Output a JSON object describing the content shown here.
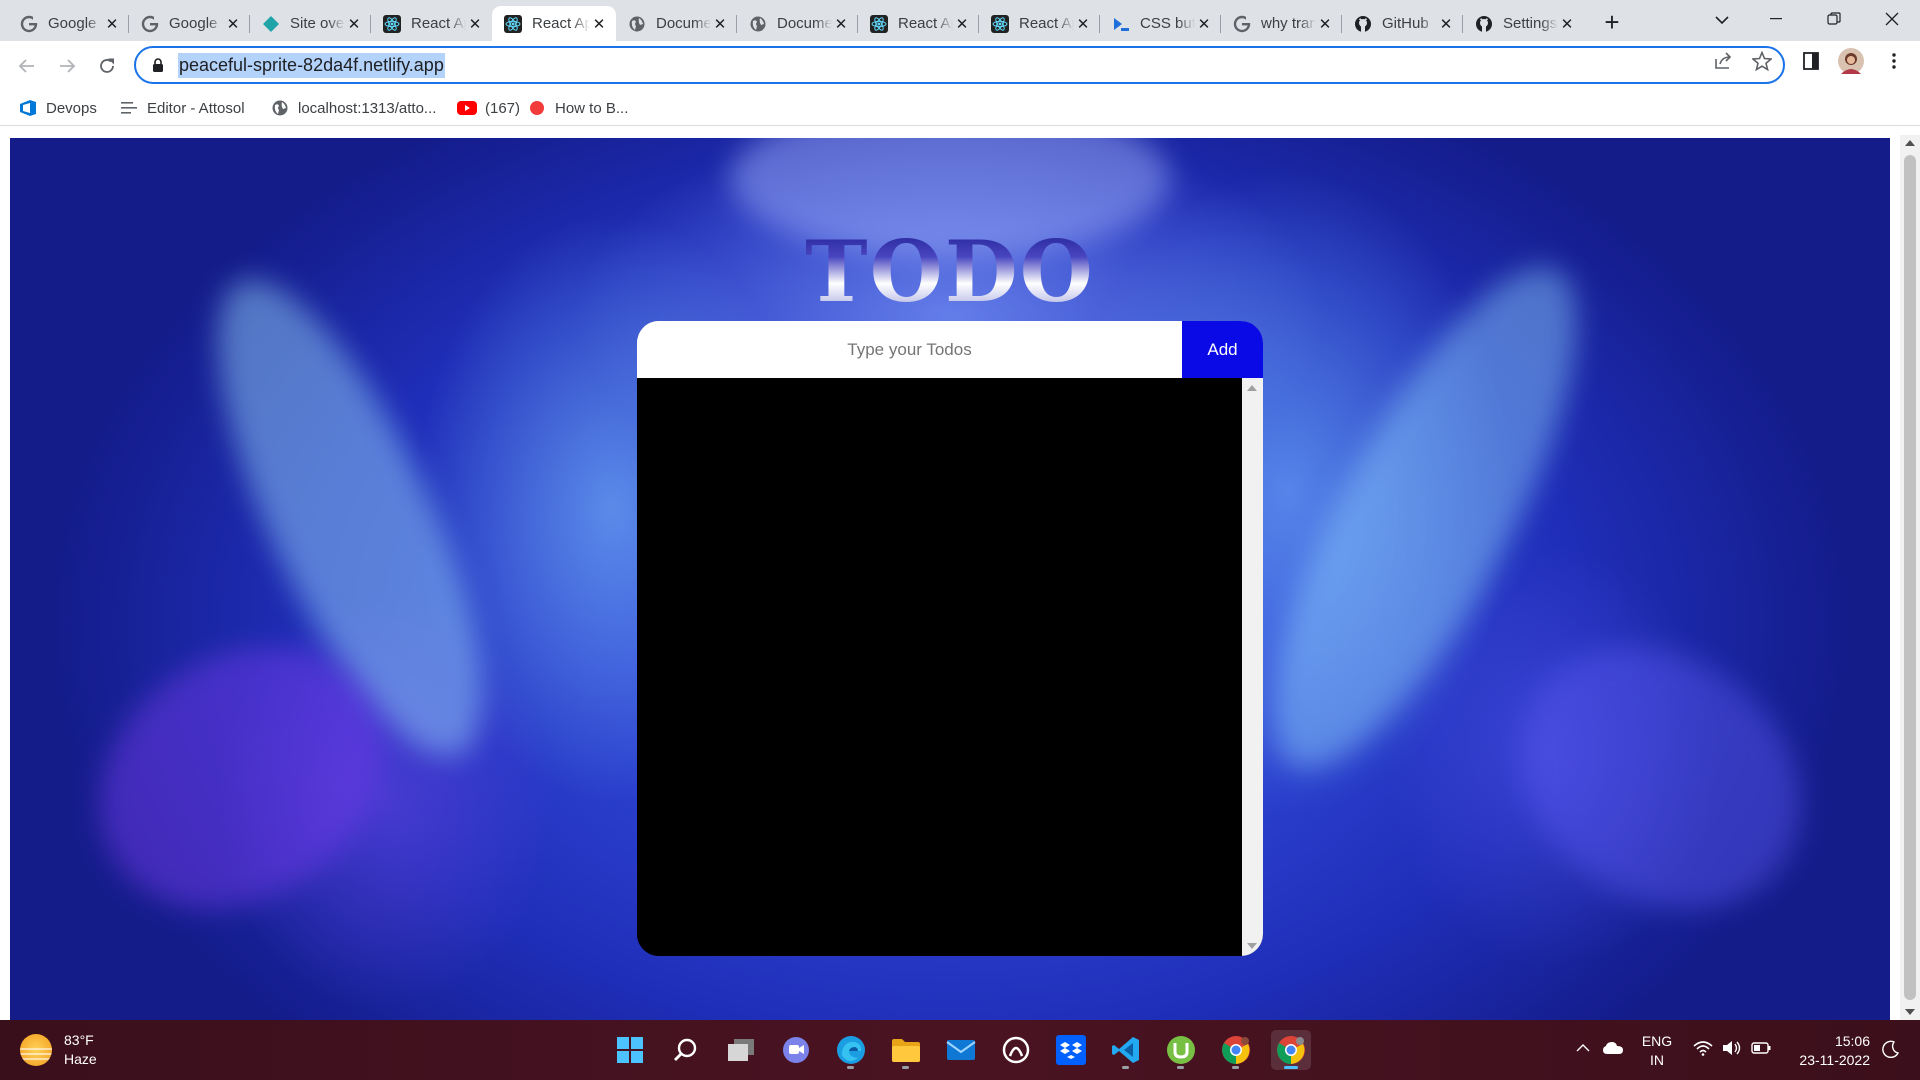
{
  "browser": {
    "tabs": [
      {
        "title": "Google",
        "icon": "google-icon"
      },
      {
        "title": "Google",
        "icon": "google-icon"
      },
      {
        "title": "Site overview",
        "icon": "netlify-icon"
      },
      {
        "title": "React App",
        "icon": "react-icon"
      },
      {
        "title": "React App",
        "icon": "react-icon",
        "active": true
      },
      {
        "title": "Document",
        "icon": "globe-icon"
      },
      {
        "title": "Document",
        "icon": "globe-icon"
      },
      {
        "title": "React App",
        "icon": "react-icon"
      },
      {
        "title": "React App",
        "icon": "react-icon"
      },
      {
        "title": "CSS button",
        "icon": "azure-icon"
      },
      {
        "title": "why transform",
        "icon": "google-icon"
      },
      {
        "title": "GitHub",
        "icon": "github-icon"
      },
      {
        "title": "Settings",
        "icon": "github-icon"
      }
    ],
    "new_tab_label": "+",
    "url": "peaceful-sprite-82da4f.netlify.app",
    "bookmarks": [
      {
        "label": "Devops",
        "icon": "azure-devops-icon"
      },
      {
        "label": "Editor - Attosol",
        "icon": "list-icon"
      },
      {
        "label": "localhost:1313/atto...",
        "icon": "globe-icon"
      },
      {
        "label": "(167)",
        "icon": "youtube-icon"
      },
      {
        "label": "How to B...",
        "icon": "red-circle-icon"
      }
    ]
  },
  "app": {
    "title": "TODO",
    "input_placeholder": "Type your Todos",
    "input_value": "",
    "add_label": "Add",
    "todos": []
  },
  "taskbar": {
    "weather": {
      "temp": "83°F",
      "condition": "Haze"
    },
    "apps": [
      "start-icon",
      "search-icon",
      "task-view-icon",
      "teams-chat-icon",
      "edge-icon",
      "file-explorer-icon",
      "mail-icon",
      "app-icon",
      "dropbox-icon",
      "vscode-icon",
      "utorrent-icon",
      "chrome-icon",
      "chrome-icon"
    ],
    "language": {
      "line1": "ENG",
      "line2": "IN"
    },
    "time": "15:06",
    "date": "23-11-2022"
  },
  "colors": {
    "accent": "#1a73e8",
    "add_button": "#0a0ae6",
    "todo_list_bg": "#000000"
  }
}
